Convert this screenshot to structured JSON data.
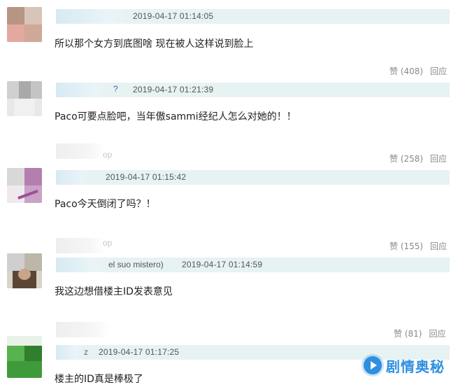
{
  "comments": [
    {
      "time": "2019-04-17 01:14:05",
      "text": "所以那个女方到底图啥 现在被人这样说到脸上",
      "likes": "赞 (408)",
      "reply": "回应"
    },
    {
      "name_tail": "?",
      "time": "2019-04-17 01:21:39",
      "text": "Paco可要点脸吧，当年傲sammi经纪人怎么对她的！！"
    },
    {
      "ghost_suffix": "op",
      "likes": "赞 (258)",
      "reply": "回应",
      "time": "2019-04-17 01:15:42",
      "text": "Paco今天倒闭了吗？！"
    },
    {
      "ghost_suffix": "op",
      "likes": "赞 (155)",
      "reply": "回应",
      "name_tail": "el suo mistero)",
      "time": "2019-04-17 01:14:59",
      "text": "我这边想借楼主ID发表意见"
    },
    {
      "likes": "赞 (81)",
      "reply": "回应",
      "name_tail": "z",
      "time": "2019-04-17 01:17:25",
      "text": "楼主的ID真是棒极了"
    }
  ],
  "watermark": {
    "text": "剧情奥秘",
    "color": "#2f8fe0"
  },
  "colors": {
    "header_bar": "#e7f2f3",
    "text": "#222222",
    "meta": "#555555",
    "action": "#888888"
  }
}
